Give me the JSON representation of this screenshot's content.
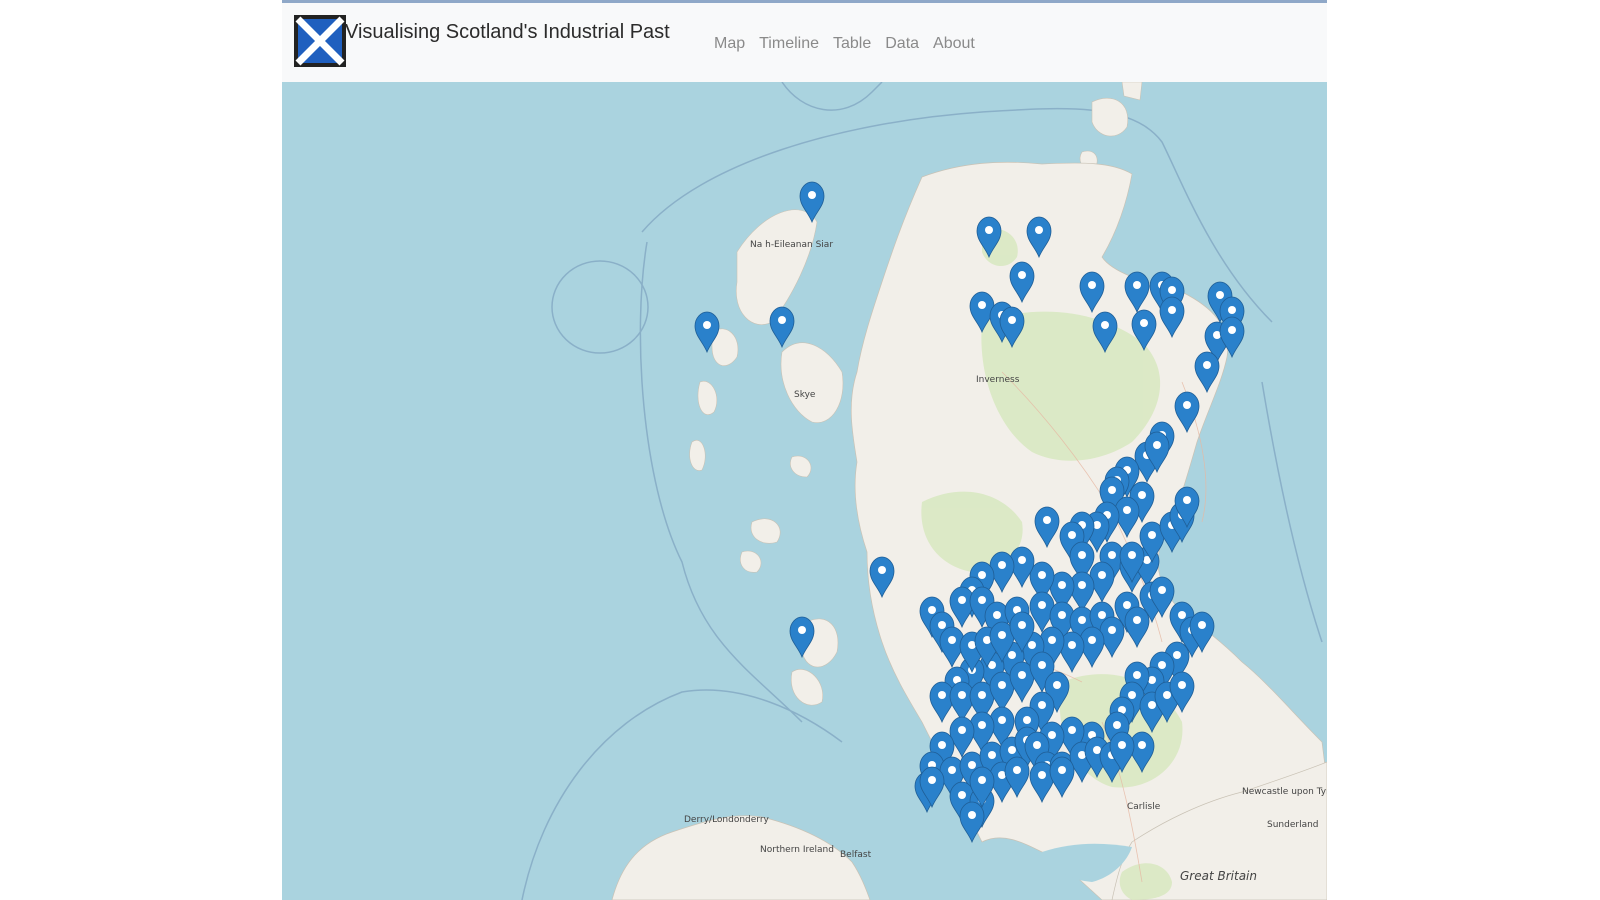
{
  "app": {
    "title": "Visualising Scotland's Industrial Past"
  },
  "nav": {
    "items": [
      "Map",
      "Timeline",
      "Table",
      "Data",
      "About"
    ]
  },
  "map": {
    "water_color": "#aad3df",
    "land_color": "#f2efe9",
    "park_color": "#d8e8c0",
    "marker_color": "#2a81cb",
    "labels": {
      "hebrides": "Na h-Eileanan Siar",
      "skye": "Skye",
      "inverness": "Inverness",
      "derry": "Derry/Londonderry",
      "ni": "Northern Ireland",
      "belfast": "Belfast",
      "carlisle": "Carlisle",
      "newcastle": "Newcastle upon Tyne",
      "sunderland": "Sunderland",
      "gb": "Great Britain"
    },
    "marker_icon": "map-pin-icon"
  }
}
